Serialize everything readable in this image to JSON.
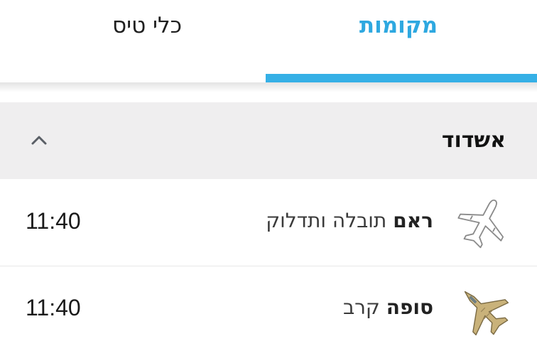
{
  "tabs": [
    {
      "label": "מקומות",
      "active": true
    },
    {
      "label": "כלי טיס",
      "active": false
    }
  ],
  "accent_color": "#35b0e6",
  "section": {
    "title": "אשדוד",
    "expanded": true
  },
  "rows": [
    {
      "name": "ראם",
      "description": "תובלה ותדלוק",
      "time": "11:40",
      "icon": "transport-plane-icon"
    },
    {
      "name": "סופה",
      "description": "קרב",
      "time": "11:40",
      "icon": "fighter-jet-icon"
    }
  ]
}
